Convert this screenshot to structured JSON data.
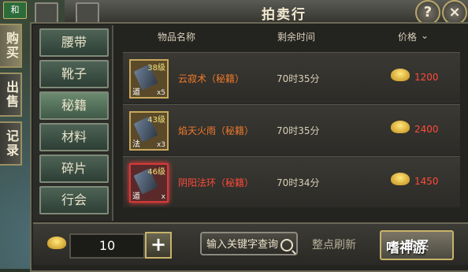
{
  "header": {
    "title": "拍卖行",
    "corner_badge": "和"
  },
  "side_tabs": [
    {
      "label": "购买",
      "active": true
    },
    {
      "label": "出售",
      "active": false
    },
    {
      "label": "记录",
      "active": false
    }
  ],
  "categories": [
    {
      "label": "腰带",
      "active": false
    },
    {
      "label": "靴子",
      "active": false
    },
    {
      "label": "秘籍",
      "active": true
    },
    {
      "label": "材料",
      "active": false
    },
    {
      "label": "碎片",
      "active": false
    },
    {
      "label": "行会",
      "active": false
    }
  ],
  "columns": {
    "name": "物品名称",
    "time": "剩余时间",
    "price": "价格"
  },
  "items": [
    {
      "name": "云寂术（秘籍）",
      "time": "70时35分",
      "price": "1200",
      "level": "38级",
      "type": "道",
      "qty": "x5",
      "highlight": false
    },
    {
      "name": "焰天火雨（秘籍）",
      "time": "70时35分",
      "price": "2400",
      "level": "43级",
      "type": "法",
      "qty": "x3",
      "highlight": false
    },
    {
      "name": "阴阳法环（秘籍）",
      "time": "70时34分",
      "price": "1450",
      "level": "46级",
      "type": "道",
      "qty": "x",
      "highlight": true
    }
  ],
  "bottom": {
    "quantity": "10",
    "search_placeholder": "输入关键字查询",
    "refresh_note": "整点刷新",
    "buy_label": "购买"
  },
  "watermark": "嗜神游",
  "colors": {
    "price": "#ff4a3a",
    "item_name": "#f07a2a"
  }
}
